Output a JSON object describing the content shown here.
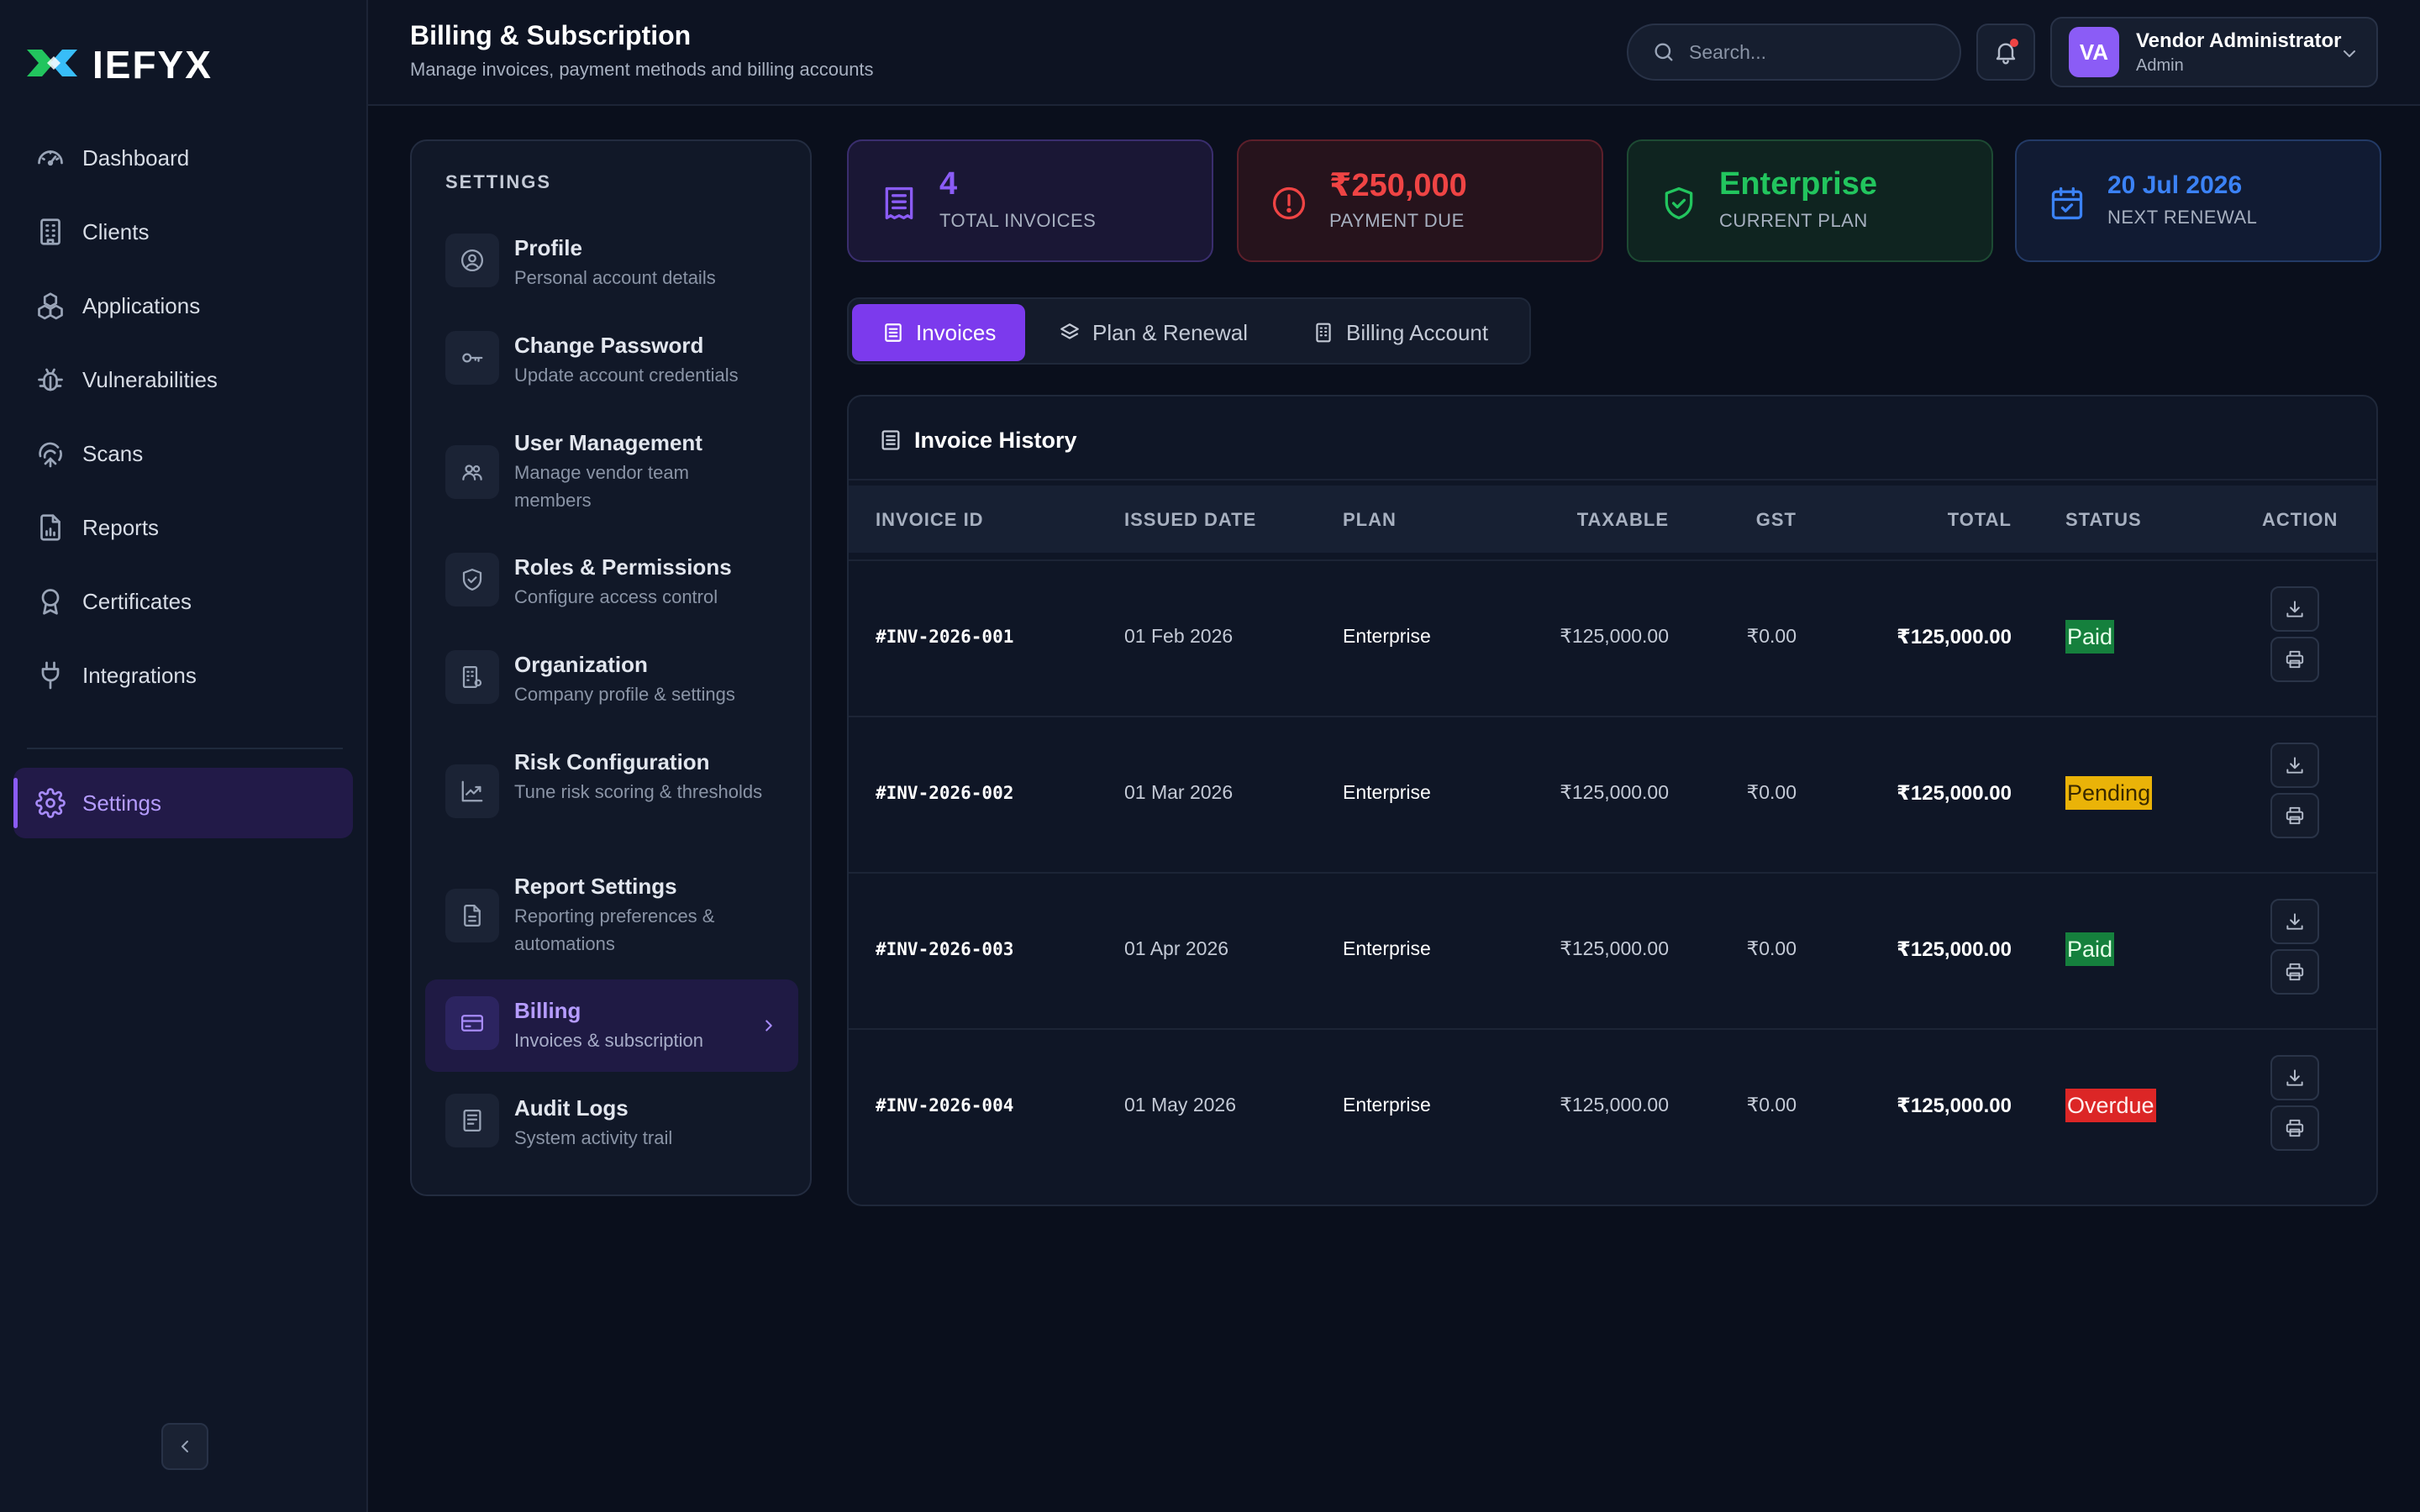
{
  "brand": {
    "name": "IEFYX",
    "accent": "#8b5cf6"
  },
  "nav": {
    "items": [
      {
        "label": "Dashboard",
        "icon": "gauge-icon"
      },
      {
        "label": "Clients",
        "icon": "building-icon"
      },
      {
        "label": "Applications",
        "icon": "cubes-icon"
      },
      {
        "label": "Vulnerabilities",
        "icon": "bug-icon"
      },
      {
        "label": "Scans",
        "icon": "radar-icon"
      },
      {
        "label": "Reports",
        "icon": "report-icon"
      },
      {
        "label": "Certificates",
        "icon": "award-icon"
      },
      {
        "label": "Integrations",
        "icon": "plug-icon"
      }
    ],
    "settings": {
      "label": "Settings",
      "icon": "gear-icon"
    }
  },
  "header": {
    "title": "Billing & Subscription",
    "subtitle": "Manage invoices, payment methods and billing accounts",
    "search_placeholder": "Search...",
    "user": {
      "initials": "VA",
      "name": "Vendor Administrator",
      "role": "Admin"
    }
  },
  "settings": {
    "heading": "SETTINGS",
    "items": [
      {
        "title": "Profile",
        "desc": "Personal account details",
        "icon": "user-circle-icon"
      },
      {
        "title": "Change Password",
        "desc": "Update account credentials",
        "icon": "key-icon"
      },
      {
        "title": "User Management",
        "desc": "Manage vendor team members",
        "icon": "users-icon"
      },
      {
        "title": "Roles & Permissions",
        "desc": "Configure access control",
        "icon": "shield-icon"
      },
      {
        "title": "Organization",
        "desc": "Company profile & settings",
        "icon": "building-gear-icon"
      },
      {
        "title": "Risk Configuration",
        "desc": "Tune risk scoring & thresholds",
        "icon": "trend-icon"
      },
      {
        "title": "Report Settings",
        "desc": "Reporting preferences & automations",
        "icon": "document-icon"
      },
      {
        "title": "Billing",
        "desc": "Invoices & subscription",
        "icon": "credit-card-icon"
      },
      {
        "title": "Audit Logs",
        "desc": "System activity trail",
        "icon": "log-icon"
      }
    ],
    "active": "Billing"
  },
  "stats": [
    {
      "value": "4",
      "label": "TOTAL INVOICES",
      "icon": "receipt-icon",
      "color": "#8b5cf6"
    },
    {
      "value": "₹250,000",
      "label": "PAYMENT DUE",
      "icon": "alert-circle-icon",
      "color": "#ef4444"
    },
    {
      "value": "Enterprise",
      "label": "CURRENT PLAN",
      "icon": "shield-check-icon",
      "color": "#22c55e"
    },
    {
      "value": "20 Jul 2026",
      "label": "NEXT RENEWAL",
      "icon": "calendar-check-icon",
      "color": "#3b82f6"
    }
  ],
  "tabs": [
    {
      "label": "Invoices",
      "icon": "list-icon"
    },
    {
      "label": "Plan & Renewal",
      "icon": "layers-icon"
    },
    {
      "label": "Billing Account",
      "icon": "building-icon"
    }
  ],
  "invoice_history": {
    "title": "Invoice History",
    "columns": [
      "INVOICE ID",
      "ISSUED DATE",
      "PLAN",
      "TAXABLE",
      "GST",
      "TOTAL",
      "STATUS",
      "ACTION"
    ],
    "rows": [
      {
        "id": "#INV-2026-001",
        "date": "01 Feb 2026",
        "plan": "Enterprise",
        "taxable": "₹125,000.00",
        "gst": "₹0.00",
        "total": "₹125,000.00",
        "status": "Paid"
      },
      {
        "id": "#INV-2026-002",
        "date": "01 Mar 2026",
        "plan": "Enterprise",
        "taxable": "₹125,000.00",
        "gst": "₹0.00",
        "total": "₹125,000.00",
        "status": "Pending"
      },
      {
        "id": "#INV-2026-003",
        "date": "01 Apr 2026",
        "plan": "Enterprise",
        "taxable": "₹125,000.00",
        "gst": "₹0.00",
        "total": "₹125,000.00",
        "status": "Paid"
      },
      {
        "id": "#INV-2026-004",
        "date": "01 May 2026",
        "plan": "Enterprise",
        "taxable": "₹125,000.00",
        "gst": "₹0.00",
        "total": "₹125,000.00",
        "status": "Overdue"
      }
    ],
    "status_colors": {
      "Paid": "#15803d",
      "Pending": "#eab308",
      "Overdue": "#dc2626"
    }
  }
}
